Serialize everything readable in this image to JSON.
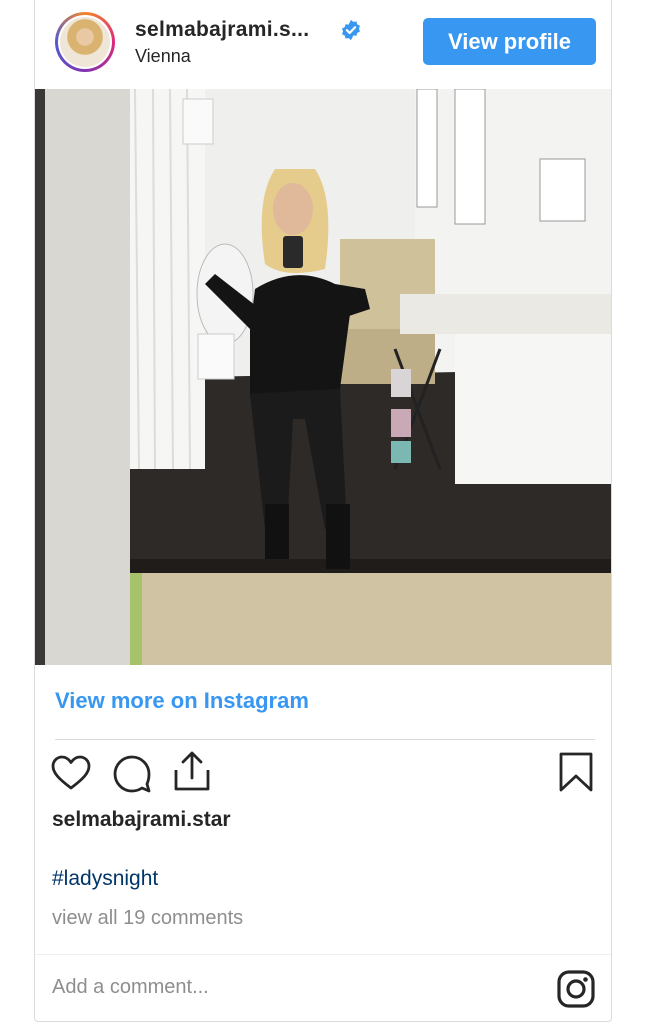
{
  "header": {
    "username": "selmabajrami.s...",
    "location": "Vienna",
    "view_profile_label": "View profile"
  },
  "post": {
    "view_more_label": "View more on Instagram",
    "handle": "selmabajrami.star",
    "caption_hashtag": "#ladysnight",
    "comments_label": "view all 19 comments",
    "add_comment_placeholder": "Add a comment..."
  },
  "icons": {
    "like": "heart-icon",
    "comment": "comment-icon",
    "share": "share-icon",
    "save": "bookmark-icon",
    "instagram": "instagram-logo-icon",
    "verified": "verified-badge-icon"
  },
  "colors": {
    "accent_blue": "#3897f0",
    "hashtag": "#003569",
    "muted_text": "#8e8e8e"
  }
}
